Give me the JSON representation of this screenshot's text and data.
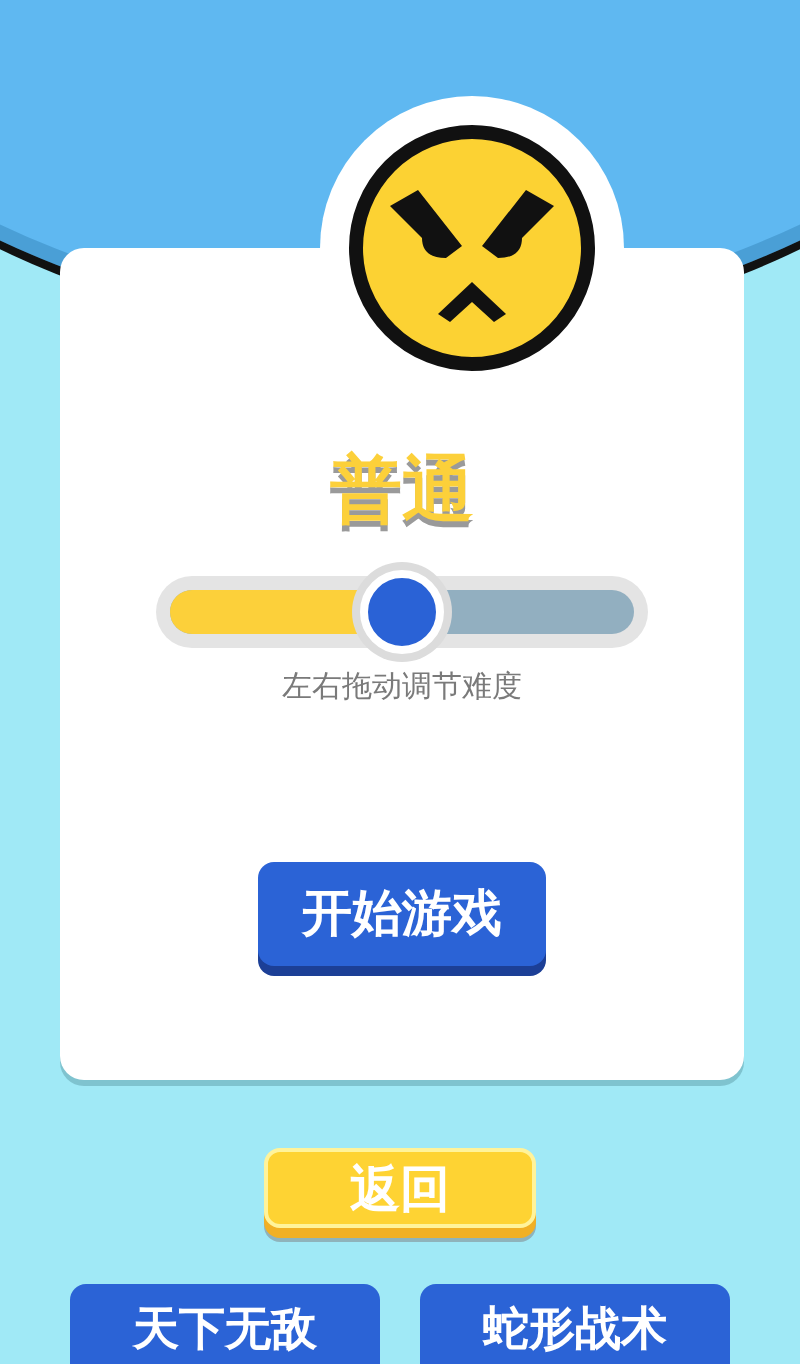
{
  "difficulty": {
    "label": "普通",
    "level": 0.5,
    "hint": "左右拖动调节难度"
  },
  "start_button": {
    "label": "开始游戏",
    "kind": "blue"
  },
  "back_button": {
    "label": "返回",
    "kind": "yellow"
  },
  "mode_buttons": [
    {
      "label": "天下无敌",
      "kind": "blue"
    },
    {
      "label": "蛇形战术",
      "kind": "blue"
    }
  ]
}
